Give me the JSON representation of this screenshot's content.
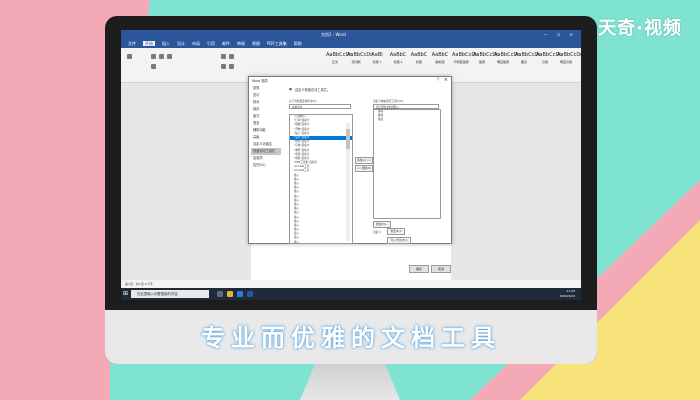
{
  "watermark": "天奇·视频",
  "caption": "专业而优雅的文档工具",
  "word": {
    "title": "文档1 - Word",
    "tabs": [
      "文件",
      "开始",
      "插入",
      "设计",
      "布局",
      "引用",
      "邮件",
      "审阅",
      "视图",
      "PDF工具集",
      "帮助"
    ],
    "active_tab": "开始",
    "styles": [
      {
        "preview": "AaBbCcDc",
        "label": "正文"
      },
      {
        "preview": "AaBbCcDc",
        "label": "无间隔"
      },
      {
        "preview": "AaBl",
        "label": "标题 1"
      },
      {
        "preview": "AaBbC",
        "label": "标题 2"
      },
      {
        "preview": "AaBbC",
        "label": "标题"
      },
      {
        "preview": "AaBbC",
        "label": "副标题"
      },
      {
        "preview": "AaBbCcDc",
        "label": "不明显强调"
      },
      {
        "preview": "AaBbCcDc",
        "label": "强调"
      },
      {
        "preview": "AaBbCcDc",
        "label": "明显强调"
      },
      {
        "preview": "AaBbCcDc",
        "label": "要点"
      },
      {
        "preview": "AaBbCcDc",
        "label": "引用"
      },
      {
        "preview": "AaBbCcDc",
        "label": "明显引用"
      }
    ],
    "status": "第1页，共1页  0个字"
  },
  "dialog": {
    "title": "Word 选项",
    "nav": [
      "常规",
      "显示",
      "校对",
      "保存",
      "版式",
      "语言",
      "辅助功能",
      "高级",
      "自定义功能区",
      "快速访问工具栏",
      "加载项",
      "信任中心"
    ],
    "nav_selected": "快速访问工具栏",
    "header": "自定义快速访问工具栏。",
    "choose_label": "从下列位置选择命令(C):",
    "choose_value": "常用命令",
    "customize_label": "自定义快速访问工具栏(Q):",
    "customize_value": "用于所有文档(默认)",
    "commands": [
      "<分隔符>",
      "\"打印\"选项卡",
      "\"视图\"选项卡",
      "\"开始\"选项卡",
      "\"插入\"选项卡",
      "\"设计\"选项卡",
      "\"布局\"选项卡",
      "\"引用\"选项卡",
      "\"邮件\"选项卡",
      "\"审阅\"选项卡",
      "\"帮助\"选项卡",
      "\"PDF工具集\"选项卡",
      "Acrobat工具",
      "Acrobat工具",
      "插入",
      "插入",
      "插入",
      "插入",
      "插入",
      "插入",
      "插入",
      "插入",
      "插入",
      "插入",
      "插入",
      "插入",
      "插入",
      "插入",
      "插入",
      "插入",
      "插入",
      "插入",
      "插入",
      "插入"
    ],
    "command_highlight": 5,
    "right_items": [
      "保存",
      "撤消",
      "恢复"
    ],
    "add_button": "添加(A) >>",
    "remove_button": "<< 删除(R)",
    "modify_button": "修改(M)...",
    "reset_label": "自定义:",
    "reset_button": "重置(E) ▾",
    "import_button": "导入/导出(P) ▾",
    "ok": "确定",
    "cancel": "取消"
  },
  "taskbar": {
    "search_placeholder": "在这里输入你要搜索的内容",
    "time": "11:29",
    "date": "2020/4/22"
  }
}
